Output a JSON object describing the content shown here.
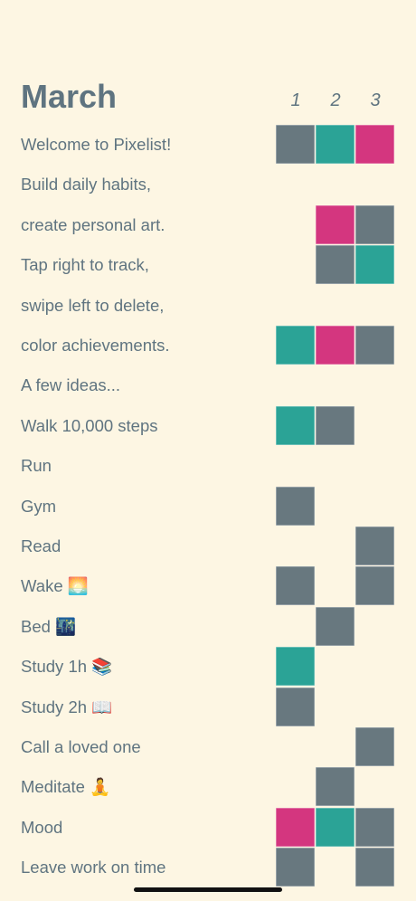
{
  "month": "March",
  "days": [
    "1",
    "2",
    "3"
  ],
  "colors": {
    "background": "#fdf6e3",
    "text": "#5f7480",
    "gray": "#68787f",
    "teal": "#2ba396",
    "pink": "#d4367f",
    "empty": "transparent"
  },
  "habits": [
    {
      "label": "Welcome to Pixelist!",
      "cells": [
        "gray",
        "teal",
        "pink"
      ]
    },
    {
      "label": "Build daily habits,",
      "cells": [
        "empty",
        "empty",
        "empty"
      ]
    },
    {
      "label": "create personal art.",
      "cells": [
        "empty",
        "pink",
        "gray"
      ]
    },
    {
      "label": "Tap right to track,",
      "cells": [
        "empty",
        "gray",
        "teal"
      ]
    },
    {
      "label": "swipe left to delete,",
      "cells": [
        "empty",
        "empty",
        "empty"
      ]
    },
    {
      "label": "color achievements.",
      "cells": [
        "teal",
        "pink",
        "gray"
      ]
    },
    {
      "label": "A few ideas...",
      "cells": [
        "empty",
        "empty",
        "empty"
      ]
    },
    {
      "label": "Walk 10,000 steps",
      "cells": [
        "teal",
        "gray",
        "empty"
      ]
    },
    {
      "label": "Run",
      "cells": [
        "empty",
        "empty",
        "empty"
      ]
    },
    {
      "label": "Gym",
      "cells": [
        "gray",
        "empty",
        "empty"
      ]
    },
    {
      "label": "Read",
      "cells": [
        "empty",
        "empty",
        "gray"
      ]
    },
    {
      "label": "Wake 🌅",
      "cells": [
        "gray",
        "empty",
        "gray"
      ]
    },
    {
      "label": "Bed 🌃",
      "cells": [
        "empty",
        "gray",
        "empty"
      ]
    },
    {
      "label": "Study 1h 📚",
      "cells": [
        "teal",
        "empty",
        "empty"
      ]
    },
    {
      "label": "Study 2h 📖",
      "cells": [
        "gray",
        "empty",
        "empty"
      ]
    },
    {
      "label": "Call a loved one",
      "cells": [
        "empty",
        "empty",
        "gray"
      ]
    },
    {
      "label": "Meditate 🧘",
      "cells": [
        "empty",
        "gray",
        "empty"
      ]
    },
    {
      "label": "Mood",
      "cells": [
        "pink",
        "teal",
        "gray"
      ]
    },
    {
      "label": "Leave work on time",
      "cells": [
        "gray",
        "empty",
        "gray"
      ]
    }
  ]
}
